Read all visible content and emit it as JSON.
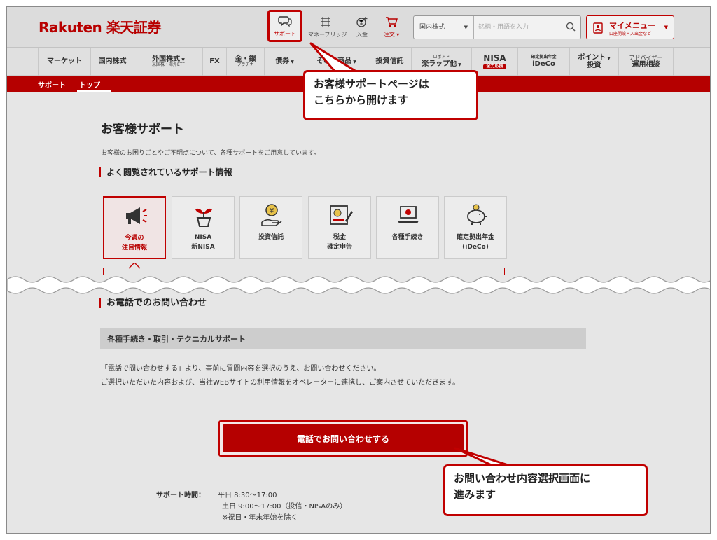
{
  "header": {
    "logo": "Rakuten 楽天証券",
    "icons": [
      {
        "name": "support",
        "label": "サポート",
        "icon": "chat-bubble-icon"
      },
      {
        "name": "money-bridge",
        "label": "マネーブリッジ",
        "icon": "bridge-icon"
      },
      {
        "name": "deposit",
        "label": "入金",
        "icon": "yen-coin-icon"
      },
      {
        "name": "order",
        "label": "注文 ▾",
        "icon": "cart-icon"
      }
    ],
    "search": {
      "select_value": "国内株式",
      "placeholder": "銘柄・用語を入力"
    },
    "my_menu": {
      "title": "マイメニュー",
      "subtitle": "口座開設・入出金など"
    }
  },
  "nav": [
    {
      "label": "マーケット"
    },
    {
      "label": "国内株式"
    },
    {
      "label": "外国株式",
      "sub": "米国株・海外ETF"
    },
    {
      "label": "FX"
    },
    {
      "label": "金・銀",
      "sub": "プラチナ"
    },
    {
      "label": "債券"
    },
    {
      "label": "その他商品"
    },
    {
      "label": "投資信託"
    },
    {
      "label": "ロボアド",
      "sub": "楽ラップ他"
    },
    {
      "label": "NISA",
      "badge": "全力応援"
    },
    {
      "label": "確定拠出年金",
      "sub": "iDeCo"
    },
    {
      "label": "ポイント",
      "sub": "投資"
    },
    {
      "label": "アドバイザー",
      "sub": "運用相談"
    }
  ],
  "breadcrumb": {
    "section": "サポート",
    "current": "トップ"
  },
  "main": {
    "title": "お客様サポート",
    "intro": "お客様のお困りごとやご不明点について、各種サポートをご用意しています。",
    "popular_heading": "よく閲覧されているサポート情報",
    "cards": [
      {
        "label": "今週の\n注目情報",
        "icon": "megaphone-icon"
      },
      {
        "label": "NISA\n新NISA",
        "icon": "sprout-icon"
      },
      {
        "label": "投資信託",
        "icon": "coin-hand-icon"
      },
      {
        "label": "税金\n確定申告",
        "icon": "tax-document-icon"
      },
      {
        "label": "各種手続き",
        "icon": "laptop-icon"
      },
      {
        "label": "確定拠出年金\n(iDeCo)",
        "icon": "piggy-bank-icon"
      }
    ],
    "phone_heading": "お電話でのお問い合わせ",
    "band_title": "各種手続き・取引・テクニカルサポート",
    "desc_line1": "「電話で問い合わせする」より、事前に質問内容を選択のうえ、お問い合わせください。",
    "desc_line2": "ご選択いただいた内容および、当社WEBサイトの利用情報をオペレーターに連携し、ご案内させていただきます。",
    "call_button": "電話でお問い合わせする",
    "hours_label": "サポート時間：",
    "hours": [
      "平日 8:30〜17:00",
      "土日 9:00〜17:00（投信・NISAのみ）",
      "※祝日・年末年始を除く"
    ]
  },
  "callouts": {
    "top": "お客様サポートページは\nこちらから開けます",
    "bottom": "お問い合わせ内容選択画面に\n進みます"
  },
  "colors": {
    "brand_red": "#b50000",
    "callout_border": "#c00000"
  }
}
